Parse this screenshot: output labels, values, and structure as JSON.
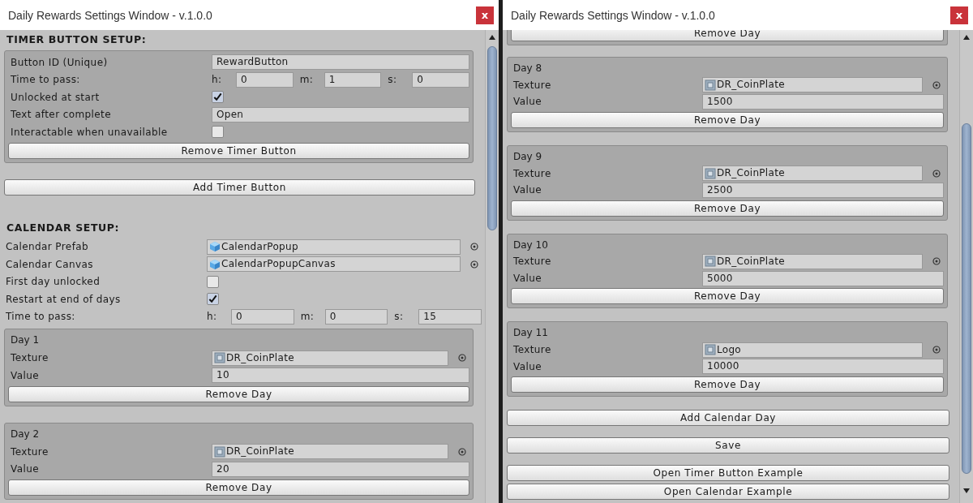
{
  "windows": [
    {
      "title": "Daily Rewards Settings Window - v.1.0.0",
      "close": "x",
      "blocks": [
        {
          "kind": "heading",
          "text": "TIMER BUTTON SETUP:"
        },
        {
          "kind": "group",
          "rows": [
            {
              "kind": "text",
              "label": "Button ID (Unique)",
              "value": "RewardButton"
            },
            {
              "kind": "time",
              "label": "Time to pass:",
              "parts": [
                {
                  "unit": "h:",
                  "value": "0"
                },
                {
                  "unit": "m:",
                  "value": "1"
                },
                {
                  "unit": "s:",
                  "value": "0"
                }
              ]
            },
            {
              "kind": "checkbox",
              "label": "Unlocked at start",
              "checked": true
            },
            {
              "kind": "text",
              "label": "Text after complete",
              "value": "Open"
            },
            {
              "kind": "checkbox",
              "label": "Interactable when unavailable",
              "checked": false
            }
          ],
          "button": "Remove Timer Button"
        },
        {
          "kind": "button",
          "text": "Add Timer Button"
        },
        {
          "kind": "heading",
          "text": "CALENDAR SETUP:"
        },
        {
          "kind": "fields",
          "rows": [
            {
              "kind": "prefab",
              "label": "Calendar Prefab",
              "value": "CalendarPopup"
            },
            {
              "kind": "prefab",
              "label": "Calendar Canvas",
              "value": "CalendarPopupCanvas"
            },
            {
              "kind": "checkbox",
              "label": "First day unlocked",
              "checked": false
            },
            {
              "kind": "checkbox",
              "label": "Restart at end of days",
              "checked": true
            },
            {
              "kind": "time",
              "label": "Time to pass:",
              "parts": [
                {
                  "unit": "h:",
                  "value": "0"
                },
                {
                  "unit": "m:",
                  "value": "0"
                },
                {
                  "unit": "s:",
                  "value": "15"
                }
              ]
            }
          ]
        },
        {
          "kind": "group",
          "title": "Day 1",
          "rows": [
            {
              "kind": "texture",
              "label": "Texture",
              "value": "DR_CoinPlate"
            },
            {
              "kind": "text",
              "label": "Value",
              "value": "10"
            }
          ],
          "button": "Remove Day"
        },
        {
          "kind": "group",
          "title": "Day 2",
          "rows": [
            {
              "kind": "texture",
              "label": "Texture",
              "value": "DR_CoinPlate"
            },
            {
              "kind": "text",
              "label": "Value",
              "value": "20"
            }
          ],
          "button": "Remove Day"
        }
      ]
    },
    {
      "title": "Daily Rewards Settings Window - v.1.0.0",
      "close": "x",
      "blocks": [
        {
          "kind": "group",
          "button": "Remove Day"
        },
        {
          "kind": "group",
          "title": "Day 8",
          "rows": [
            {
              "kind": "texture",
              "label": "Texture",
              "value": "DR_CoinPlate"
            },
            {
              "kind": "text",
              "label": "Value",
              "value": "1500"
            }
          ],
          "button": "Remove Day"
        },
        {
          "kind": "group",
          "title": "Day 9",
          "rows": [
            {
              "kind": "texture",
              "label": "Texture",
              "value": "DR_CoinPlate"
            },
            {
              "kind": "text",
              "label": "Value",
              "value": "2500"
            }
          ],
          "button": "Remove Day"
        },
        {
          "kind": "group",
          "title": "Day 10",
          "rows": [
            {
              "kind": "texture",
              "label": "Texture",
              "value": "DR_CoinPlate"
            },
            {
              "kind": "text",
              "label": "Value",
              "value": "5000"
            }
          ],
          "button": "Remove Day"
        },
        {
          "kind": "group",
          "title": "Day 11",
          "rows": [
            {
              "kind": "texture",
              "label": "Texture",
              "value": "Logo"
            },
            {
              "kind": "text",
              "label": "Value",
              "value": "10000"
            }
          ],
          "button": "Remove Day"
        },
        {
          "kind": "button",
          "text": "Add Calendar Day"
        },
        {
          "kind": "button",
          "text": "Save"
        },
        {
          "kind": "button",
          "text": "Open Timer Button Example"
        },
        {
          "kind": "button",
          "text": "Open Calendar Example"
        }
      ]
    }
  ]
}
